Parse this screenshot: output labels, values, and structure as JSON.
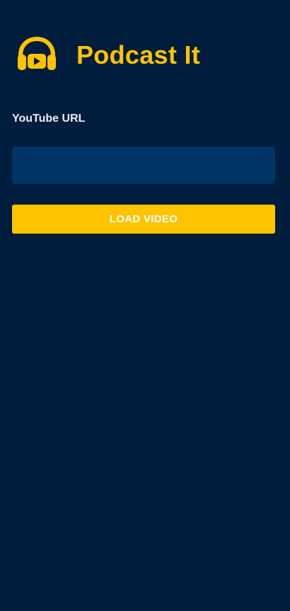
{
  "app": {
    "title": "Podcast It",
    "logo_icon": "headphones-play-icon"
  },
  "form": {
    "url_label": "YouTube URL",
    "url_value": "",
    "url_placeholder": "",
    "load_button_label": "LOAD VIDEO"
  },
  "colors": {
    "background": "#001d3d",
    "accent": "#ffc300",
    "input_background": "#003566",
    "label_text": "#e8edf3",
    "button_text": "#ffffff"
  }
}
